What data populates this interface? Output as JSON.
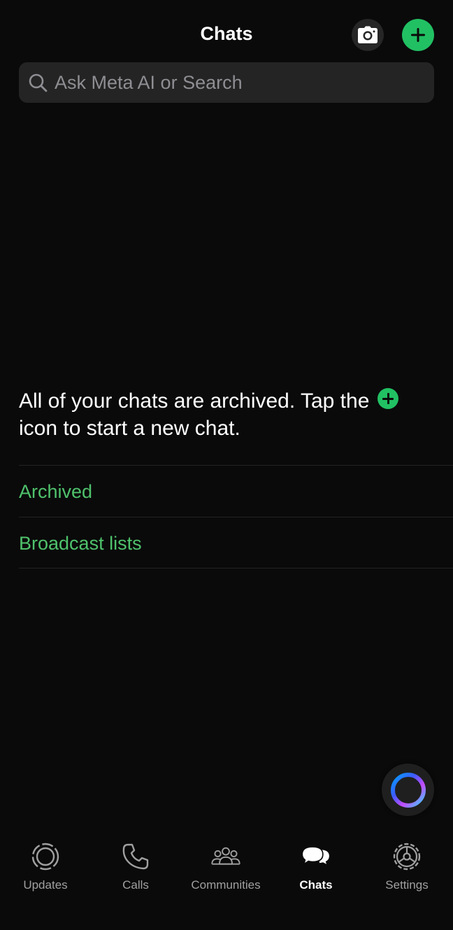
{
  "header": {
    "title": "Chats",
    "camera_icon": "camera-icon",
    "new_chat_icon": "plus-icon"
  },
  "search": {
    "placeholder": "Ask Meta AI or Search",
    "icon": "search-icon"
  },
  "empty_state": {
    "message_part1": "All of your chats are archived. Tap the",
    "message_part2": "icon to start a new chat."
  },
  "lists": {
    "archived_label": "Archived",
    "broadcast_label": "Broadcast lists"
  },
  "meta_ai": {
    "icon": "meta-ai-ring-icon"
  },
  "tabbar": {
    "items": [
      {
        "label": "Updates",
        "icon": "updates-icon",
        "active": false
      },
      {
        "label": "Calls",
        "icon": "phone-icon",
        "active": false
      },
      {
        "label": "Communities",
        "icon": "communities-icon",
        "active": false
      },
      {
        "label": "Chats",
        "icon": "chat-bubbles-icon",
        "active": true
      },
      {
        "label": "Settings",
        "icon": "gear-icon",
        "active": false
      }
    ]
  },
  "colors": {
    "background": "#0a0a0a",
    "accent": "#21c063",
    "link_green": "#4fc26c",
    "search_bg": "#242424",
    "muted_text": "#a0a0a0"
  }
}
